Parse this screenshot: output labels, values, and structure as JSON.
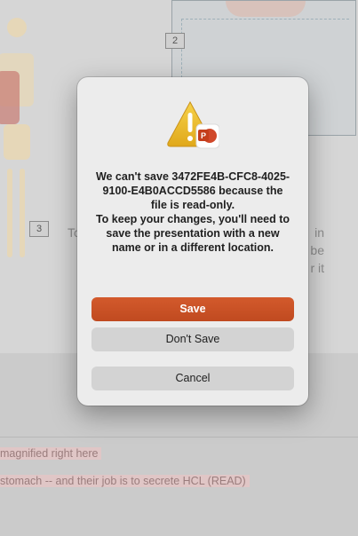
{
  "background": {
    "diagram_label": "2",
    "slide_number_label": "3",
    "slide_text_left": "To",
    "slide_text_right": [
      "in",
      "be",
      "r it"
    ]
  },
  "notes": {
    "line1": "magnified right here",
    "line2": "stomach -- and their job is to secrete HCL (READ)"
  },
  "dialog": {
    "icon": "warning-powerpoint-icon",
    "message_line1": "We can't save 3472FE4B-CFC8-4025-9100-E4B0ACCD5586 because the file is read-only.",
    "message_line2": "To keep your changes, you'll need to save the presentation with a new name or in a different location.",
    "save_label": "Save",
    "dont_save_label": "Don't Save",
    "cancel_label": "Cancel",
    "accent_color": "#c9542a"
  }
}
